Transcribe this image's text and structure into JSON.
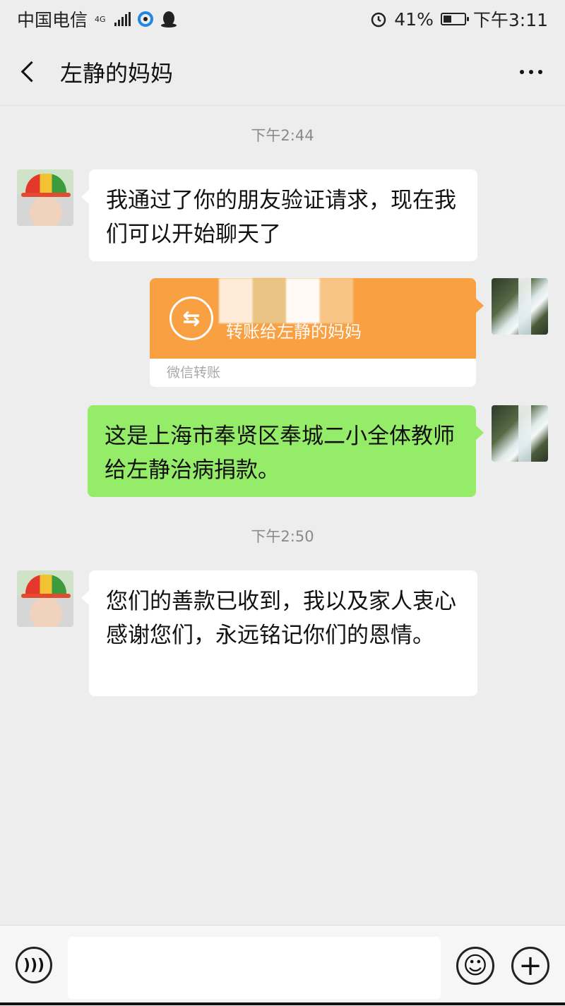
{
  "status_bar": {
    "carrier": "中国电信",
    "network": "4G",
    "battery_percent": "41%",
    "battery_level": 0.41,
    "time": "下午3:11",
    "icons": [
      "signal-icon",
      "sync-app-icon",
      "qq-icon",
      "alarm-icon",
      "battery-icon"
    ]
  },
  "header": {
    "title": "左静的妈妈",
    "back_icon": "chevron-left-icon",
    "more_icon": "more-dots-icon"
  },
  "messages": {
    "time1": "下午2:44",
    "msg1": "我通过了你的朋友验证请求，现在我们可以开始聊天了",
    "transfer_label": "转账给左静的妈妈",
    "transfer_footer": "微信转账",
    "msg2": "这是上海市奉贤区奉城二小全体教师给左静治病捐款。",
    "time2": "下午2:50",
    "msg3": "您们的善款已收到，我以及家人衷心感谢您们，永远铭记你们的恩情。"
  },
  "input_bar": {
    "placeholder": "",
    "icons": [
      "voice-icon",
      "emoji-icon",
      "plus-icon"
    ]
  },
  "colors": {
    "background": "#ededed",
    "sent_bubble": "#95ec69",
    "received_bubble": "#ffffff",
    "transfer_orange": "#f9a043"
  }
}
